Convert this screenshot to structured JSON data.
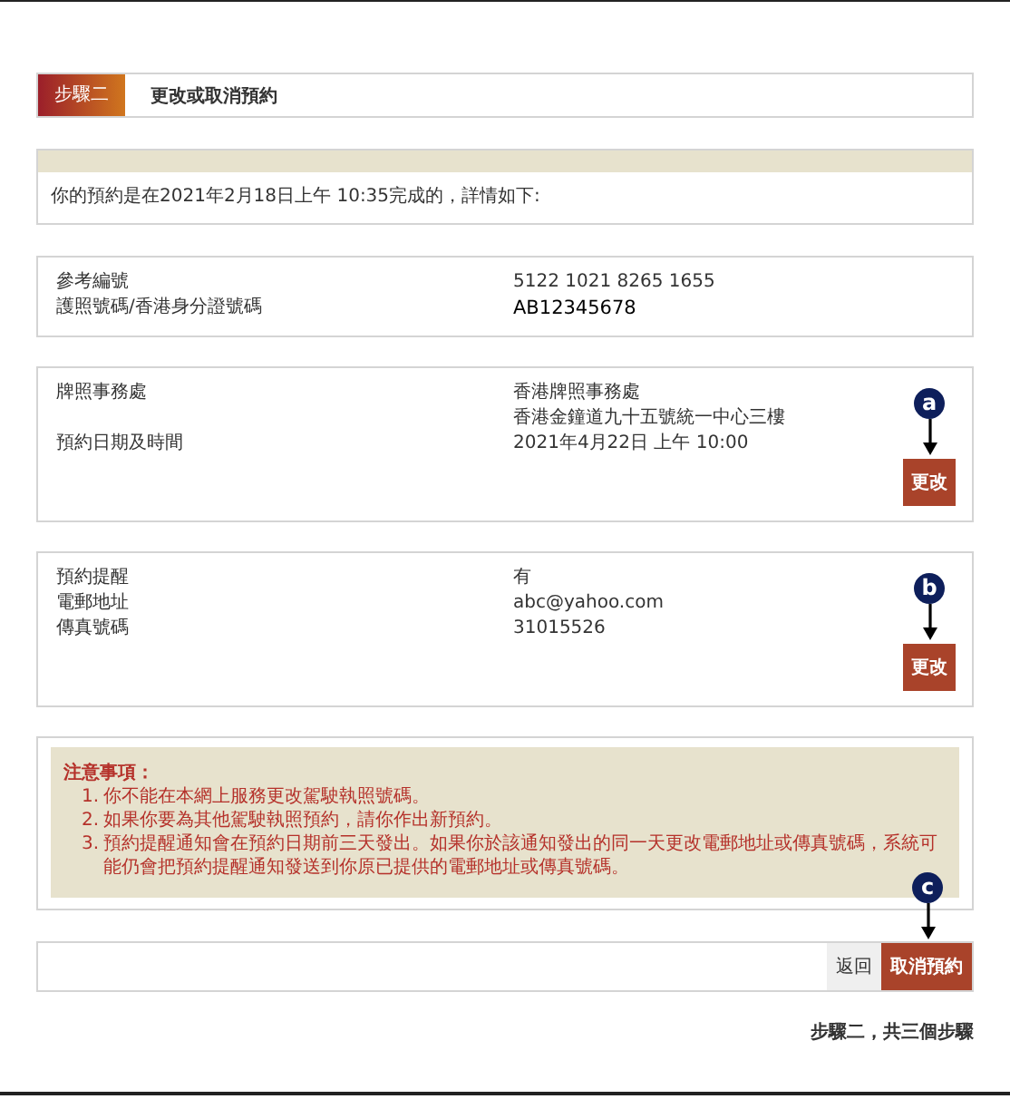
{
  "step": {
    "badge": "步驟二",
    "title": "更改或取消預約"
  },
  "intro": "你的預約是在2021年2月18日上午 10:35完成的，詳情如下:",
  "sections": [
    {
      "rows": [
        {
          "label": "參考編號",
          "value_lines": [
            "5122 1021 8265 1655"
          ]
        },
        {
          "label": "護照號碼/香港身分證號碼",
          "value_lines": [
            "AB12345678"
          ],
          "emphasis": true
        }
      ]
    },
    {
      "rows": [
        {
          "label": "牌照事務處",
          "value_lines": [
            "香港牌照事務處",
            "香港金鐘道九十五號統一中心三樓"
          ]
        },
        {
          "label": "預約日期及時間",
          "value_lines": [
            "2021年4月22日 上午 10:00"
          ]
        }
      ],
      "button": "更改",
      "callout": "a"
    },
    {
      "rows": [
        {
          "label": "預約提醒",
          "value_lines": [
            "有"
          ]
        },
        {
          "label": "電郵地址",
          "value_lines": [
            "abc@yahoo.com"
          ]
        },
        {
          "label": "傳真號碼",
          "value_lines": [
            "31015526"
          ]
        }
      ],
      "button": "更改",
      "callout": "b"
    }
  ],
  "notes": {
    "title": "注意事項：",
    "items": [
      {
        "number": "1.",
        "text": "你不能在本網上服務更改駕駛執照號碼。"
      },
      {
        "number": "2.",
        "text": "如果你要為其他駕駛執照預約，請你作出新預約。"
      },
      {
        "number": "3.",
        "text": "預約提醒通知會在預約日期前三天發出。如果你於該通知發出的同一天更改電郵地址或傳真號碼，系統可能仍會把預約提醒通知發送到你原已提供的電郵地址或傳真號碼。"
      }
    ]
  },
  "actions": {
    "back": "返回",
    "cancel": "取消預約",
    "callout": "c"
  },
  "footer": "步驟二，共三個步驟"
}
